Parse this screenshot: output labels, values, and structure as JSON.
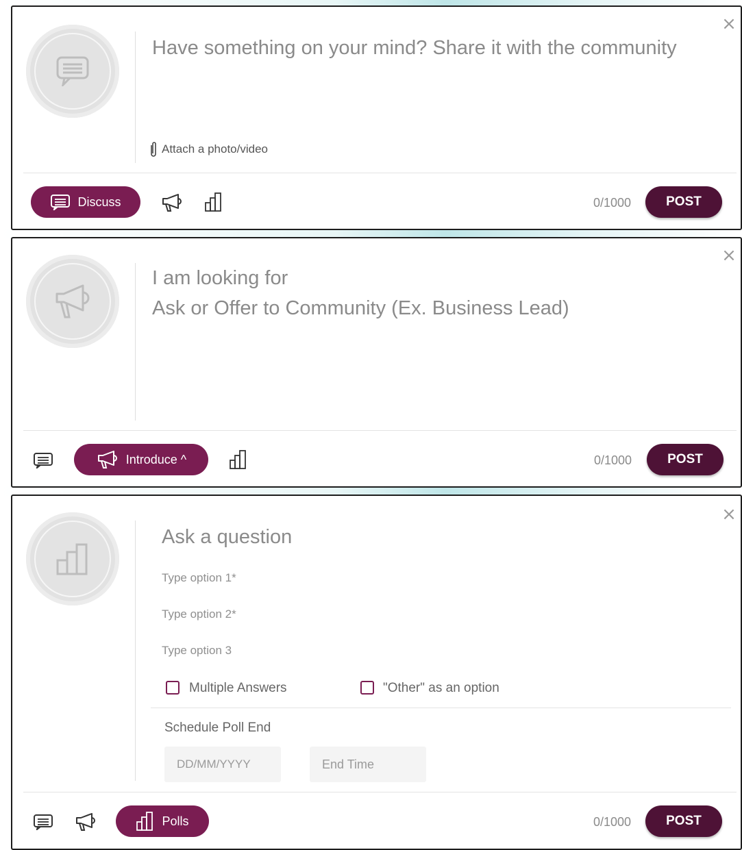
{
  "common": {
    "counter": "0/1000",
    "post_label": "POST",
    "close_glyph": "×"
  },
  "discuss_card": {
    "placeholder": "Have something on your mind? Share it with the community",
    "attach_label": "Attach a photo/video",
    "active_button_label": "Discuss"
  },
  "introduce_card": {
    "title": "I am looking for",
    "placeholder": "Ask or Offer to Community (Ex. Business Lead)",
    "active_button_label": "Introduce ^"
  },
  "polls_card": {
    "question_placeholder": "Ask a question",
    "options": [
      "Type option 1*",
      "Type option 2*",
      "Type option 3"
    ],
    "checkbox_multiple": "Multiple Answers",
    "checkbox_other": "\"Other\" as an option",
    "schedule_label": "Schedule Poll End",
    "date_placeholder": "DD/MM/YYYY",
    "time_placeholder": "End Time",
    "active_button_label": "Polls"
  },
  "colors": {
    "accent": "#7a1d52",
    "post_button": "#4e1236",
    "text_muted": "#8a8a8a"
  },
  "icons": {
    "discuss": "chat-bubble-icon",
    "introduce": "megaphone-icon",
    "polls": "bar-chart-icon",
    "attach": "paperclip-icon",
    "close": "close-icon"
  }
}
